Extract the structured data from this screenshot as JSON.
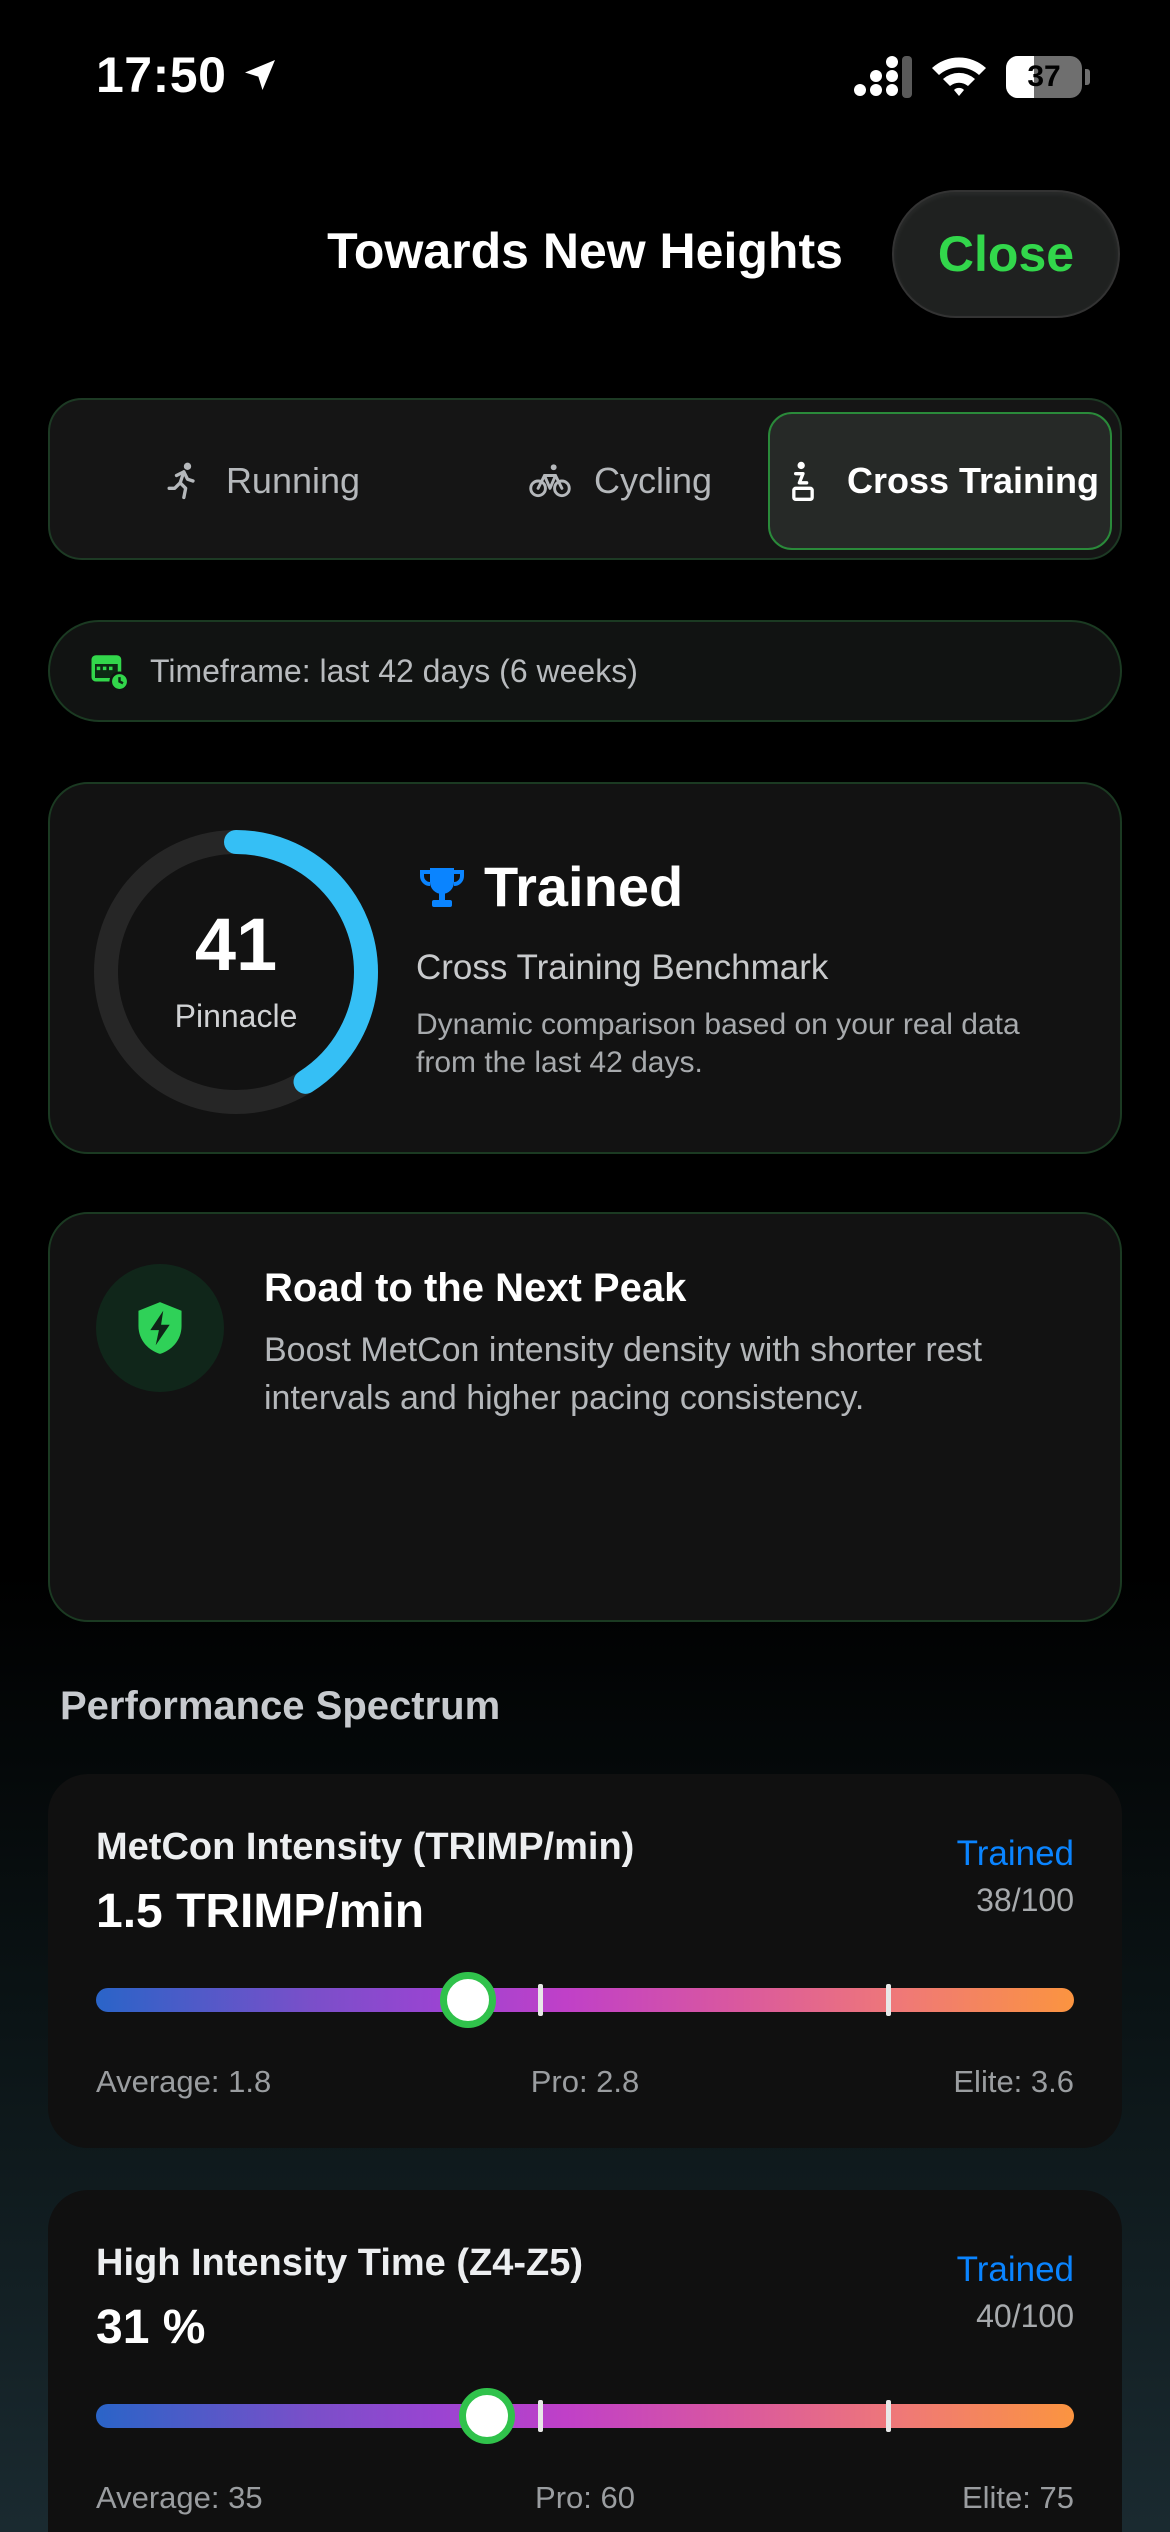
{
  "status": {
    "time": "17:50",
    "battery": "37",
    "battery_level": 0.37
  },
  "header": {
    "title": "Towards New Heights",
    "close_label": "Close"
  },
  "tabs": [
    {
      "label": "Running",
      "icon": "runner-icon",
      "selected": false
    },
    {
      "label": "Cycling",
      "icon": "bicycle-icon",
      "selected": false
    },
    {
      "label": "Cross Training",
      "icon": "cross-training-icon",
      "selected": true
    }
  ],
  "timeframe": {
    "label": "Timeframe: last 42 days (6 weeks)",
    "icon": "calendar-clock-icon"
  },
  "score": {
    "value": "41",
    "ring_label": "Pinnacle",
    "ring_progress": 0.41,
    "level": "Trained",
    "benchmark": "Cross Training Benchmark",
    "description": "Dynamic comparison based on your real data from the last 42 days.",
    "colors": {
      "ring": "#35bff5",
      "track": "#262626",
      "trophy": "#0a84ff"
    }
  },
  "next_peak": {
    "title": "Road to the Next Peak",
    "description": "Boost MetCon intensity density with shorter rest intervals and higher pacing consistency.",
    "icon": "shield-bolt-icon"
  },
  "spectrum": {
    "title": "Performance Spectrum",
    "metrics": [
      {
        "name": "MetCon Intensity (TRIMP/min)",
        "value": "1.5 TRIMP/min",
        "level": "Trained",
        "score": "38/100",
        "position": 0.38,
        "ticks": [
          0.455,
          0.81
        ],
        "average": "Average: 1.8",
        "pro": "Pro: 2.8",
        "elite": "Elite: 3.6"
      },
      {
        "name": "High Intensity Time (Z4-Z5)",
        "value": "31 %",
        "level": "Trained",
        "score": "40/100",
        "position": 0.4,
        "ticks": [
          0.455,
          0.81
        ],
        "average": "Average: 35",
        "pro": "Pro: 60",
        "elite": "Elite: 75"
      }
    ]
  }
}
